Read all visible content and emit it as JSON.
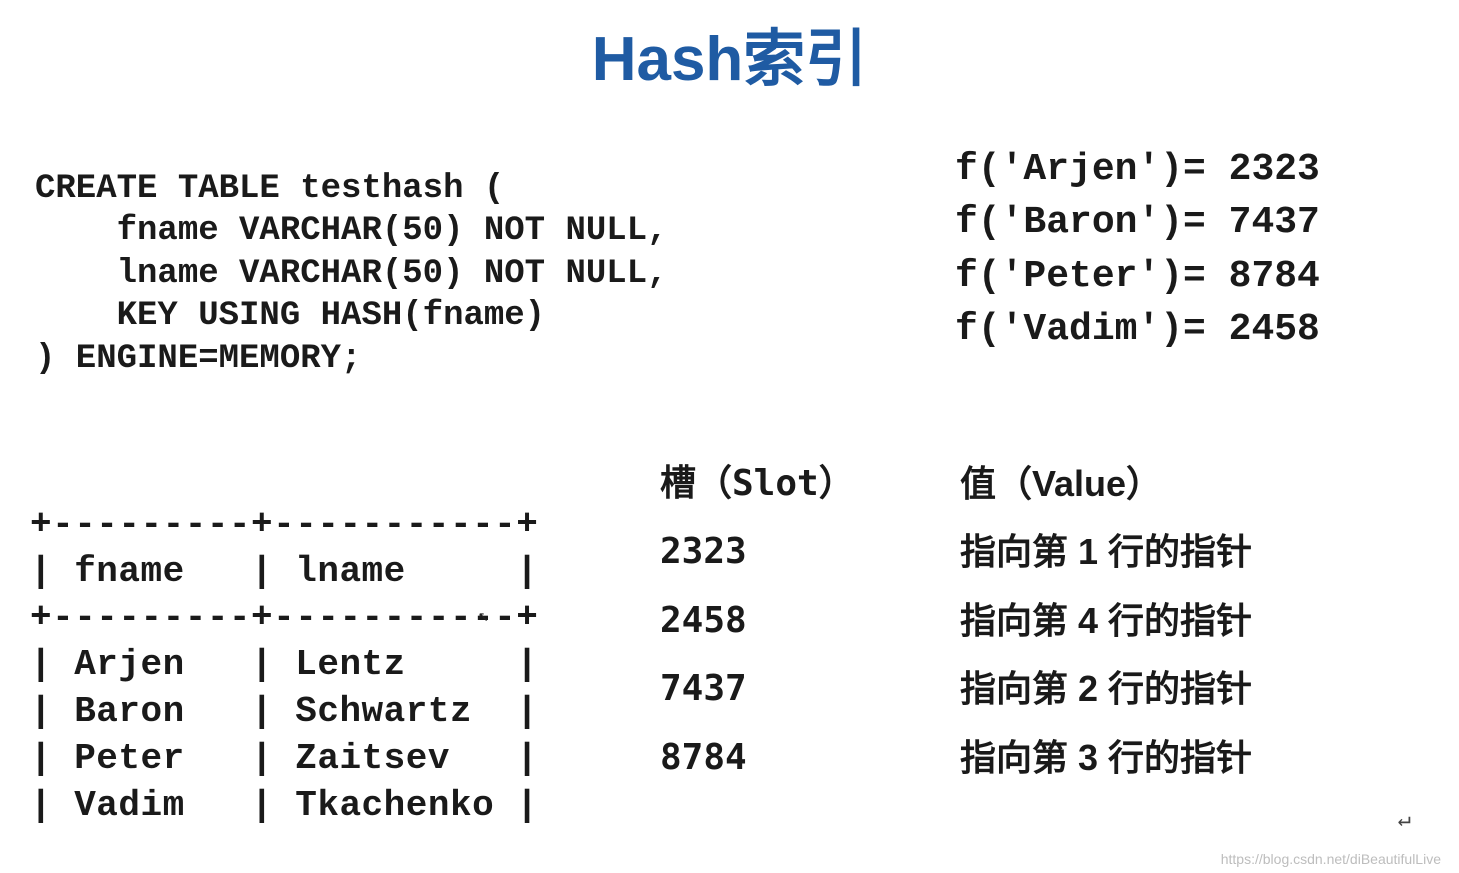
{
  "title": "Hash索引",
  "sql": {
    "line1": "CREATE TABLE testhash (",
    "line2": "    fname VARCHAR(50) NOT NULL,",
    "line3": "    lname VARCHAR(50) NOT NULL,",
    "line4": "    KEY USING HASH(fname)",
    "line5": ") ENGINE=MEMORY;"
  },
  "hash_fn": {
    "line1": "f('Arjen')= 2323",
    "line2": "f('Baron')= 7437",
    "line3": "f('Peter')= 8784",
    "line4": "f('Vadim')= 2458"
  },
  "data_table": {
    "border_top": "+---------+-----------+",
    "header": "| fname   | lname     |",
    "border_mid": "+---------+-----------+",
    "row1": "| Arjen   | Lentz     |",
    "row2": "| Baron   | Schwartz  |",
    "row3": "| Peter   | Zaitsev   |",
    "row4": "| Vadim   | Tkachenko |"
  },
  "slot_table": {
    "header_slot": "槽（Slot）",
    "header_value": "值（Value）",
    "rows": [
      {
        "slot": "2323",
        "value": "指向第 1 行的指针"
      },
      {
        "slot": "2458",
        "value": "指向第 4 行的指针"
      },
      {
        "slot": "7437",
        "value": "指向第 2 行的指针"
      },
      {
        "slot": "8784",
        "value": "指向第 3 行的指针"
      }
    ]
  },
  "watermark": "https://blog.csdn.net/diBeautifulLive",
  "return_symbol": "↵"
}
